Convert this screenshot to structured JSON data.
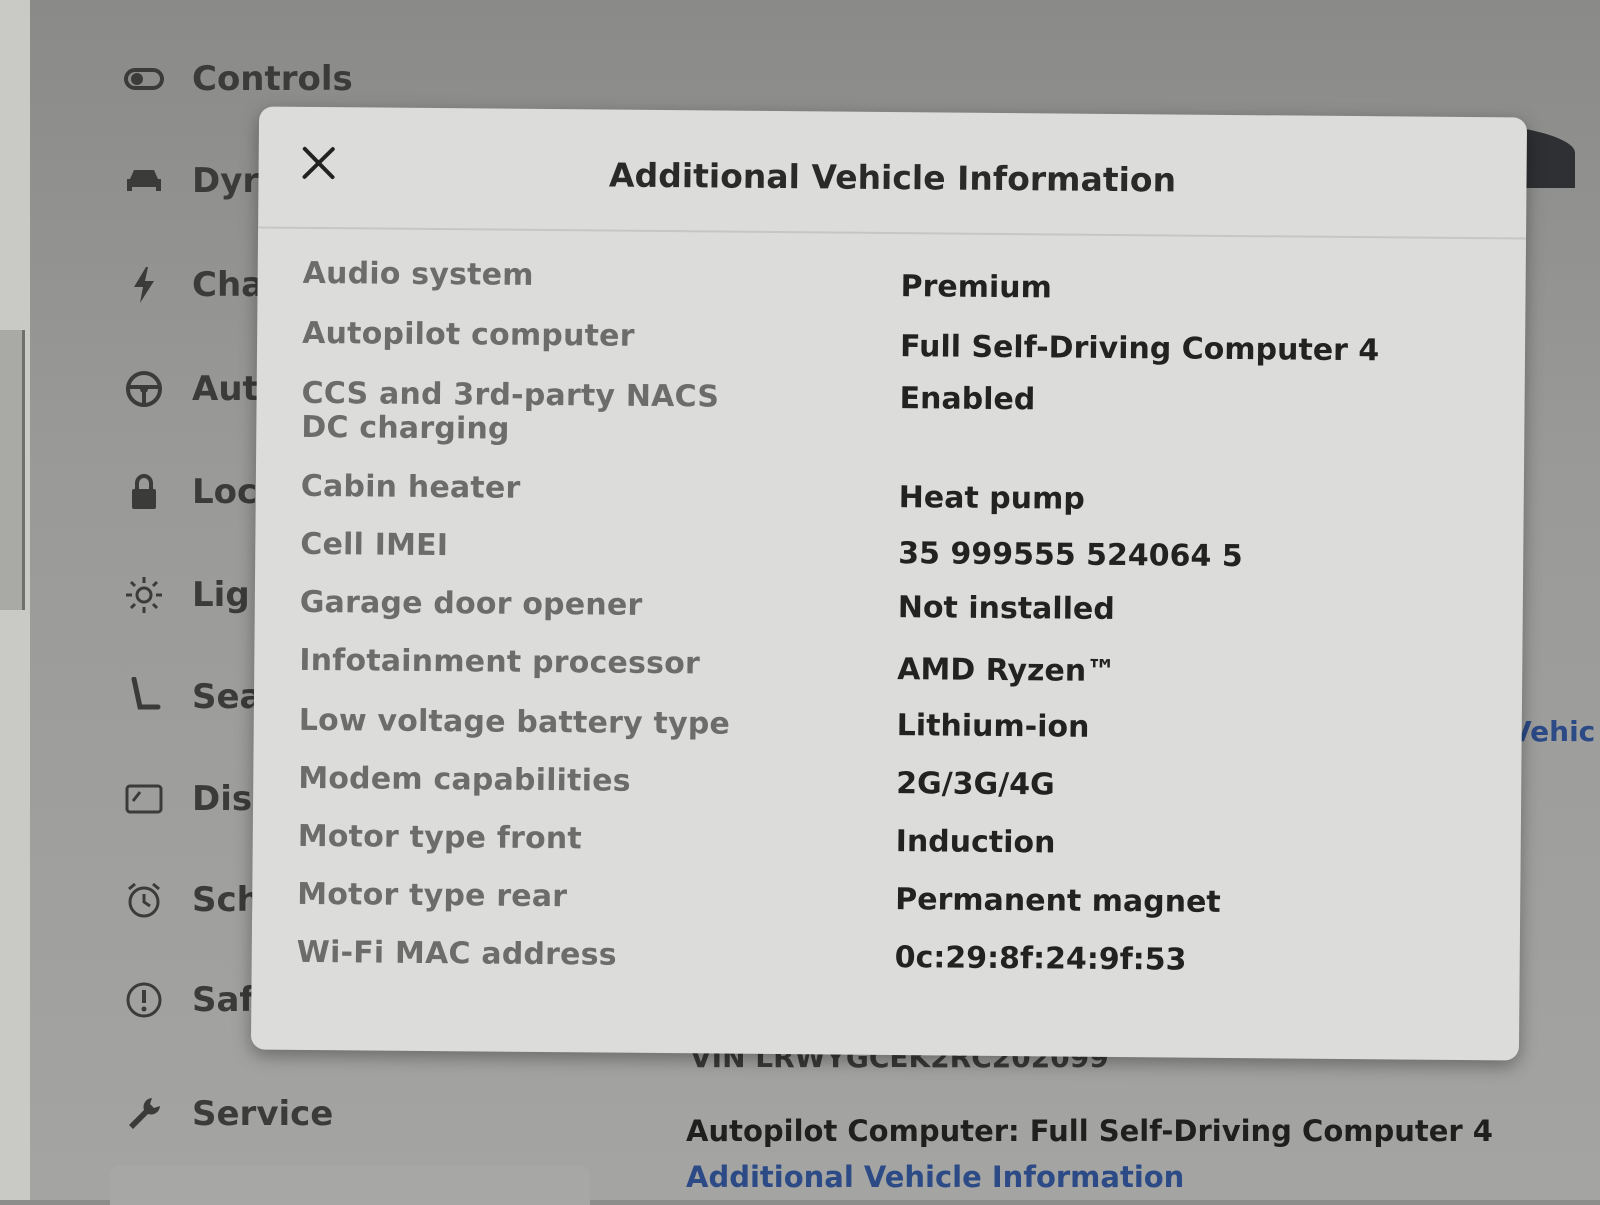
{
  "sidebar": {
    "items": [
      {
        "label": "Controls",
        "icon": "toggle-icon"
      },
      {
        "label": "Dyr",
        "icon": "car-icon"
      },
      {
        "label": "Cha",
        "icon": "bolt-icon"
      },
      {
        "label": "Aut",
        "icon": "steering-wheel-icon"
      },
      {
        "label": "Loc",
        "icon": "lock-icon"
      },
      {
        "label": "Lig",
        "icon": "sun-icon"
      },
      {
        "label": "Sea",
        "icon": "seat-icon"
      },
      {
        "label": "Dis",
        "icon": "display-icon"
      },
      {
        "label": "Sch",
        "icon": "alarm-clock-icon"
      },
      {
        "label": "Saf",
        "icon": "alert-icon"
      },
      {
        "label": "Service",
        "icon": "wrench-icon"
      }
    ]
  },
  "modal": {
    "title": "Additional Vehicle Information",
    "close_icon": "close-icon",
    "rows": [
      {
        "key": "Audio system",
        "value": "Premium"
      },
      {
        "key": "Autopilot computer",
        "value": "Full Self-Driving Computer 4"
      },
      {
        "key": "CCS and 3rd-party NACS DC charging",
        "value": "Enabled"
      },
      {
        "key": "Cabin heater",
        "value": "Heat pump"
      },
      {
        "key": "Cell IMEI",
        "value": "35 999555 524064 5"
      },
      {
        "key": "Garage door opener",
        "value": "Not installed"
      },
      {
        "key": "Infotainment processor",
        "value": "AMD Ryzen™"
      },
      {
        "key": "Low voltage battery type",
        "value": "Lithium-ion"
      },
      {
        "key": "Modem capabilities",
        "value": "2G/3G/4G"
      },
      {
        "key": "Motor type front",
        "value": "Induction"
      },
      {
        "key": "Motor type rear",
        "value": "Permanent magnet"
      },
      {
        "key": "Wi-Fi MAC address",
        "value": "0c:29:8f:24:9f:53"
      }
    ]
  },
  "background": {
    "autopilot_label": "Autopilot Computer: Full Self-Driving Computer 4",
    "additional_link": "Additional Vehicle Information",
    "vin_partial": "VIN LRWYGCEK2RC202099",
    "right_link_partial": "Vehic"
  },
  "colors": {
    "modal_bg": "#dcdcda",
    "key_text": "#6c6c6a",
    "value_text": "#222221",
    "link": "#2b4a86"
  }
}
